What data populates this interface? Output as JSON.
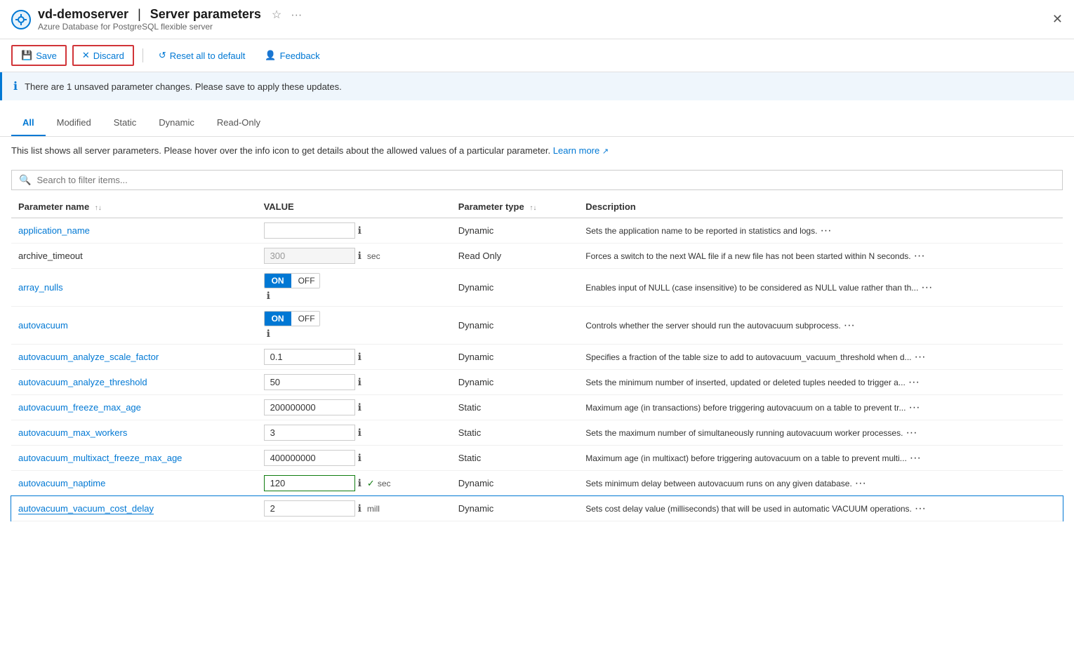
{
  "titleBar": {
    "icon": "gear",
    "serverName": "vd-demoserver",
    "separator": "|",
    "pageTitle": "Server parameters",
    "subtitle": "Azure Database for PostgreSQL flexible server"
  },
  "toolbar": {
    "saveLabel": "Save",
    "discardLabel": "Discard",
    "resetLabel": "Reset all to default",
    "feedbackLabel": "Feedback"
  },
  "infoBanner": {
    "message": "There are 1 unsaved parameter changes.  Please save to apply these updates."
  },
  "tabs": [
    {
      "label": "All",
      "active": true
    },
    {
      "label": "Modified",
      "active": false
    },
    {
      "label": "Static",
      "active": false
    },
    {
      "label": "Dynamic",
      "active": false
    },
    {
      "label": "Read-Only",
      "active": false
    }
  ],
  "description": {
    "text": "This list shows all server parameters. Please hover over the info icon to get details about the allowed values of a particular parameter.",
    "linkText": "Learn more",
    "linkIcon": "↗"
  },
  "search": {
    "placeholder": "Search to filter items..."
  },
  "tableHeaders": {
    "paramName": "Parameter name",
    "value": "VALUE",
    "paramType": "Parameter type",
    "description": "Description"
  },
  "rows": [
    {
      "paramName": "application_name",
      "isLink": true,
      "value": "",
      "valueType": "input",
      "unit": "",
      "paramType": "Dynamic",
      "description": "Sets the application name to be reported in statistics and logs.",
      "modified": false,
      "disabled": false
    },
    {
      "paramName": "archive_timeout",
      "isLink": false,
      "value": "300",
      "valueType": "input",
      "unit": "sec",
      "paramType": "Read Only",
      "description": "Forces a switch to the next WAL file if a new file has not been started within N seconds.",
      "modified": false,
      "disabled": true
    },
    {
      "paramName": "array_nulls",
      "isLink": true,
      "value": "ON",
      "valueType": "toggle",
      "unit": "",
      "paramType": "Dynamic",
      "description": "Enables input of NULL (case insensitive) to be considered as NULL value rather than th...",
      "modified": false,
      "disabled": false
    },
    {
      "paramName": "autovacuum",
      "isLink": true,
      "value": "ON",
      "valueType": "toggle",
      "unit": "",
      "paramType": "Dynamic",
      "description": "Controls whether the server should run the autovacuum subprocess.",
      "modified": false,
      "disabled": false
    },
    {
      "paramName": "autovacuum_analyze_scale_factor",
      "isLink": true,
      "value": "0.1",
      "valueType": "input",
      "unit": "",
      "paramType": "Dynamic",
      "description": "Specifies a fraction of the table size to add to autovacuum_vacuum_threshold when d...",
      "modified": false,
      "disabled": false
    },
    {
      "paramName": "autovacuum_analyze_threshold",
      "isLink": true,
      "value": "50",
      "valueType": "input",
      "unit": "",
      "paramType": "Dynamic",
      "description": "Sets the minimum number of inserted, updated or deleted tuples needed to trigger a...",
      "modified": false,
      "disabled": false
    },
    {
      "paramName": "autovacuum_freeze_max_age",
      "isLink": true,
      "value": "200000000",
      "valueType": "input",
      "unit": "",
      "paramType": "Static",
      "description": "Maximum age (in transactions) before triggering autovacuum on a table to prevent tr...",
      "modified": false,
      "disabled": false
    },
    {
      "paramName": "autovacuum_max_workers",
      "isLink": true,
      "value": "3",
      "valueType": "input",
      "unit": "",
      "paramType": "Static",
      "description": "Sets the maximum number of simultaneously running autovacuum worker processes.",
      "modified": false,
      "disabled": false
    },
    {
      "paramName": "autovacuum_multixact_freeze_max_age",
      "isLink": true,
      "value": "400000000",
      "valueType": "input",
      "unit": "",
      "paramType": "Static",
      "description": "Maximum age (in multixact) before triggering autovacuum on a table to prevent multi...",
      "modified": false,
      "disabled": false
    },
    {
      "paramName": "autovacuum_naptime",
      "isLink": true,
      "value": "120",
      "valueType": "input",
      "unit": "sec",
      "paramType": "Dynamic",
      "description": "Sets minimum delay between autovacuum runs on any given database.",
      "modified": true,
      "disabled": false
    },
    {
      "paramName": "autovacuum_vacuum_cost_delay",
      "isLink": true,
      "value": "2",
      "valueType": "input",
      "unit": "mill",
      "paramType": "Dynamic",
      "description": "Sets cost delay value (milliseconds) that will be used in automatic VACUUM operations.",
      "modified": false,
      "disabled": false,
      "selected": true
    }
  ]
}
